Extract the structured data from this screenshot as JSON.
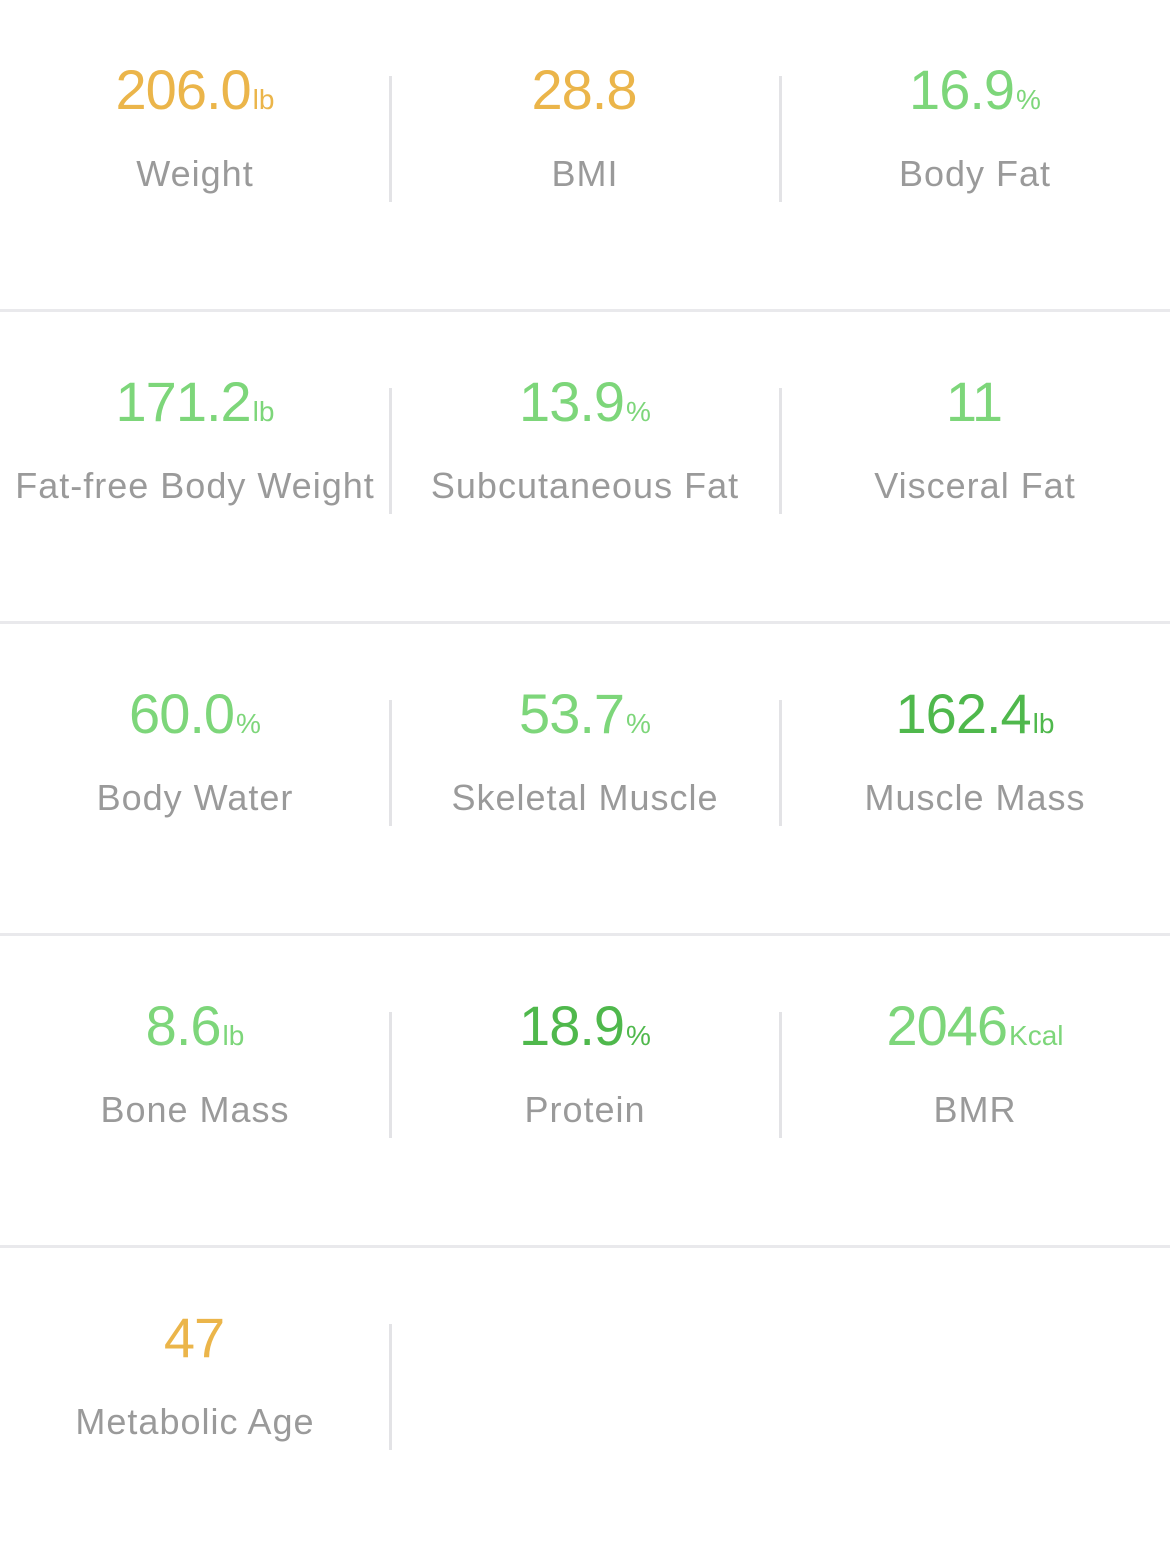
{
  "colors": {
    "orange": "#ebb54a",
    "light_green": "#7dd67a",
    "dark_green": "#4fb84c",
    "label_gray": "#9a9a9a"
  },
  "metrics": [
    {
      "value": "206.0",
      "unit": "lb",
      "label": "Weight",
      "color": "#ebb54a"
    },
    {
      "value": "28.8",
      "unit": "",
      "label": "BMI",
      "color": "#ebb54a"
    },
    {
      "value": "16.9",
      "unit": "%",
      "label": "Body Fat",
      "color": "#7dd67a"
    },
    {
      "value": "171.2",
      "unit": "lb",
      "label": "Fat-free Body Weight",
      "color": "#7dd67a"
    },
    {
      "value": "13.9",
      "unit": "%",
      "label": "Subcutaneous Fat",
      "color": "#7dd67a"
    },
    {
      "value": "11",
      "unit": "",
      "label": "Visceral Fat",
      "color": "#7dd67a"
    },
    {
      "value": "60.0",
      "unit": "%",
      "label": "Body Water",
      "color": "#7dd67a"
    },
    {
      "value": "53.7",
      "unit": "%",
      "label": "Skeletal Muscle",
      "color": "#7dd67a"
    },
    {
      "value": "162.4",
      "unit": "lb",
      "label": "Muscle Mass",
      "color": "#4fb84c"
    },
    {
      "value": "8.6",
      "unit": "lb",
      "label": "Bone Mass",
      "color": "#7dd67a"
    },
    {
      "value": "18.9",
      "unit": "%",
      "label": "Protein",
      "color": "#4fb84c"
    },
    {
      "value": "2046",
      "unit": "Kcal",
      "label": "BMR",
      "color": "#7dd67a"
    },
    {
      "value": "47",
      "unit": "",
      "label": "Metabolic Age",
      "color": "#ebb54a"
    }
  ]
}
